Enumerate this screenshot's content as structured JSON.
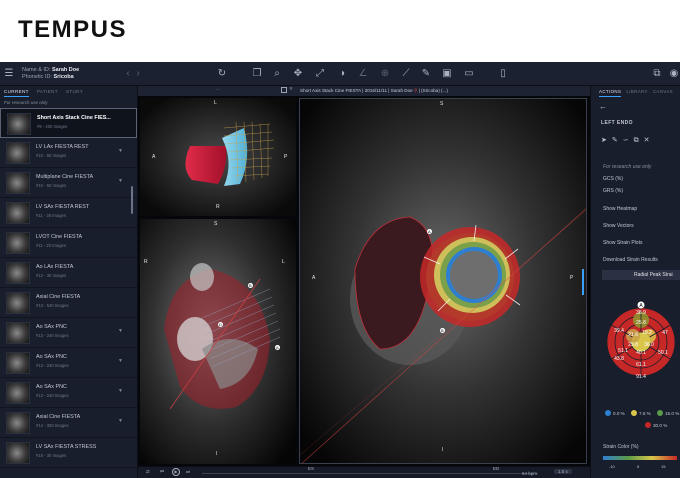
{
  "brand": {
    "logo_text": "TEMPUS"
  },
  "patient": {
    "name_label": "Name & ID:",
    "name_value": "Sarah Doe",
    "phonetic_label": "Phonetic ID:",
    "phonetic_value": "Sricoba"
  },
  "left_panel": {
    "tabs": [
      "CURRENT",
      "PATIENT",
      "STUDY"
    ],
    "note": "For research use only",
    "series": [
      {
        "name": "Short Axis Stack Cine FIES...",
        "count": "#9 - 200 Images"
      },
      {
        "name": "LV LAx FIESTA REST",
        "count": "#10 - 50 Images"
      },
      {
        "name": "Multiplane Cine FIESTA",
        "count": "#10 - 50 Images"
      },
      {
        "name": "LV SAx FIESTA REST",
        "count": "#11 - 30 Images"
      },
      {
        "name": "LVOT Cine FIESTA",
        "count": "#11 - 20 Images"
      },
      {
        "name": "Ao LAx FIESTA",
        "count": "#12 - 30 Images"
      },
      {
        "name": "Axial Cine FIESTA",
        "count": "#13 - 540 Images"
      },
      {
        "name": "Ao SAx PNC",
        "count": "#13 - 240 Images"
      },
      {
        "name": "Ao SAx PNC",
        "count": "#13 - 240 Images"
      },
      {
        "name": "Ao SAx PNC",
        "count": "#13 - 240 Images"
      },
      {
        "name": "Axial Cine FIESTA",
        "count": "#14 - 300 Images"
      },
      {
        "name": "LV SAx FIESTA STRESS",
        "count": "#15 - 30 Images"
      }
    ]
  },
  "viewer": {
    "menu_dots": "...",
    "header_title": "Short Axis Stack Cine FIESTA",
    "header_date": "2016/11/11",
    "header_patient": "Sarah Doe",
    "header_phonetic": "(Sricoba)",
    "header_more": "(...)",
    "orient": {
      "S": "S",
      "I": "I",
      "A": "A",
      "P": "P",
      "L": "L",
      "R": "R"
    },
    "slice_marks": {
      "A": "A",
      "B": "B",
      "D": "D"
    },
    "bottom": {
      "es": "ES",
      "ed": "ED",
      "bpm": "64 bpm",
      "speed": "1.0 x"
    }
  },
  "right_panel": {
    "tabs": [
      "ACTIONS",
      "LIBRARY",
      "CANVAS"
    ],
    "section": "LEFT ENDO",
    "note": "For research use only",
    "gcs": "GCS (%)",
    "grs": "GRS (%)",
    "actions": [
      "Show Heatmap",
      "Show Vectors",
      "Show Strain Plots",
      "Download Strain Results"
    ],
    "chart_button": "Radial Peak Strai",
    "bullseye_values": [
      "38.9",
      "25.8",
      "39.4",
      "21.6",
      "19.2",
      "47",
      "29.8",
      "36.0",
      "51.1",
      "40.1",
      "50.1",
      "43.8",
      "61.1",
      "91.4"
    ],
    "bullseye_label": "A",
    "legend": [
      "0.0 %",
      "7.5 %",
      "15.0 %",
      "30.0 %"
    ],
    "strain_color": "Strain Color (%)",
    "scale": [
      "-10",
      "5",
      "15"
    ],
    "colors": {
      "red": "#c62828",
      "olive": "#8d9a2e",
      "yellow": "#d9c54a",
      "tan": "#c9a14a",
      "blue": "#2f7fd0",
      "green": "#5a9a4a",
      "accent": "#3aa0ff"
    }
  }
}
